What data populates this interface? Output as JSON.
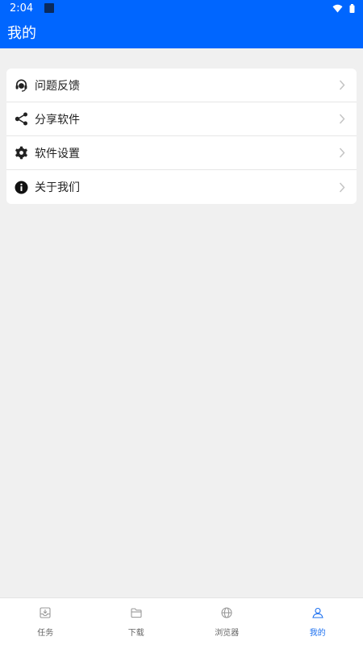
{
  "status_bar": {
    "time": "2:04"
  },
  "app_bar": {
    "title": "我的"
  },
  "menu": {
    "items": [
      {
        "label": "问题反馈",
        "icon": "headset-icon"
      },
      {
        "label": "分享软件",
        "icon": "share-icon"
      },
      {
        "label": "软件设置",
        "icon": "gear-icon"
      },
      {
        "label": "关于我们",
        "icon": "info-icon"
      }
    ]
  },
  "bottom_nav": {
    "items": [
      {
        "label": "任务",
        "icon": "inbox-icon"
      },
      {
        "label": "下载",
        "icon": "folder-icon"
      },
      {
        "label": "浏览器",
        "icon": "globe-icon"
      },
      {
        "label": "我的",
        "icon": "person-icon",
        "active": true
      }
    ]
  },
  "colors": {
    "primary": "#0066ff",
    "background": "#f0f0f0",
    "active_tab": "#1a6ff0",
    "inactive_tab": "#666666"
  }
}
